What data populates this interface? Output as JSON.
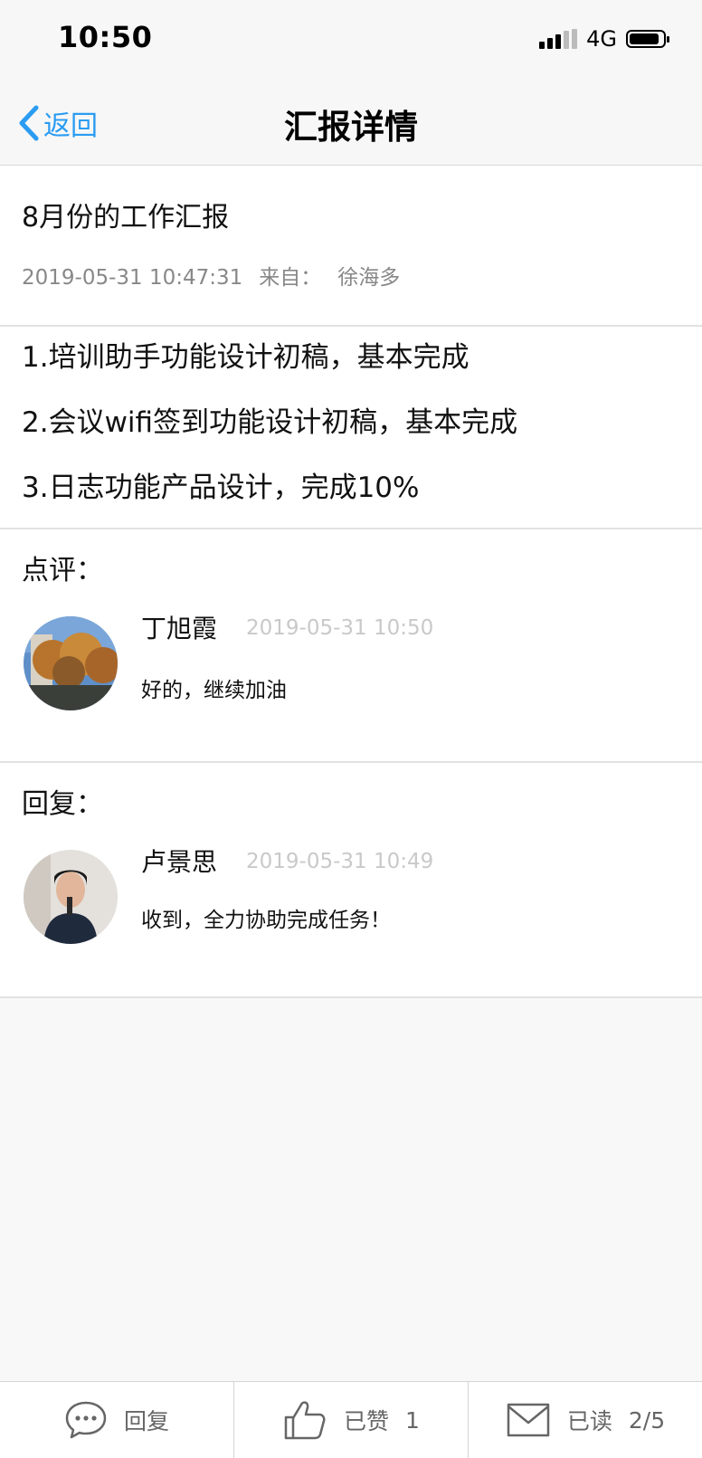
{
  "status_bar": {
    "time": "10:50",
    "network": "4G"
  },
  "nav": {
    "back_label": "返回",
    "title": "汇报详情"
  },
  "report": {
    "title": "8月份的工作汇报",
    "datetime": "2019-05-31 10:47:31",
    "from_label": "来自：",
    "author": "徐海多",
    "lines": [
      "1.培训助手功能设计初稿，基本完成",
      "2.会议wifi签到功能设计初稿，基本完成",
      "3.日志功能产品设计，完成10%"
    ]
  },
  "comment": {
    "label": "点评：",
    "name": "丁旭霞",
    "time": "2019-05-31 10:50",
    "text": "好的，继续加油"
  },
  "reply": {
    "label": "回复：",
    "name": "卢景思",
    "time": "2019-05-31 10:49",
    "text": "收到，全力协助完成任务！"
  },
  "bottom_bar": {
    "reply_label": "回复",
    "like_label": "已赞",
    "like_count": "1",
    "read_label": "已读",
    "read_count": "2/5"
  },
  "colors": {
    "accent": "#2b9cf2",
    "background": "#f8f8f8"
  },
  "icons": [
    "chevron-left-icon",
    "chat-bubble-icon",
    "thumbs-up-icon",
    "envelope-icon"
  ]
}
